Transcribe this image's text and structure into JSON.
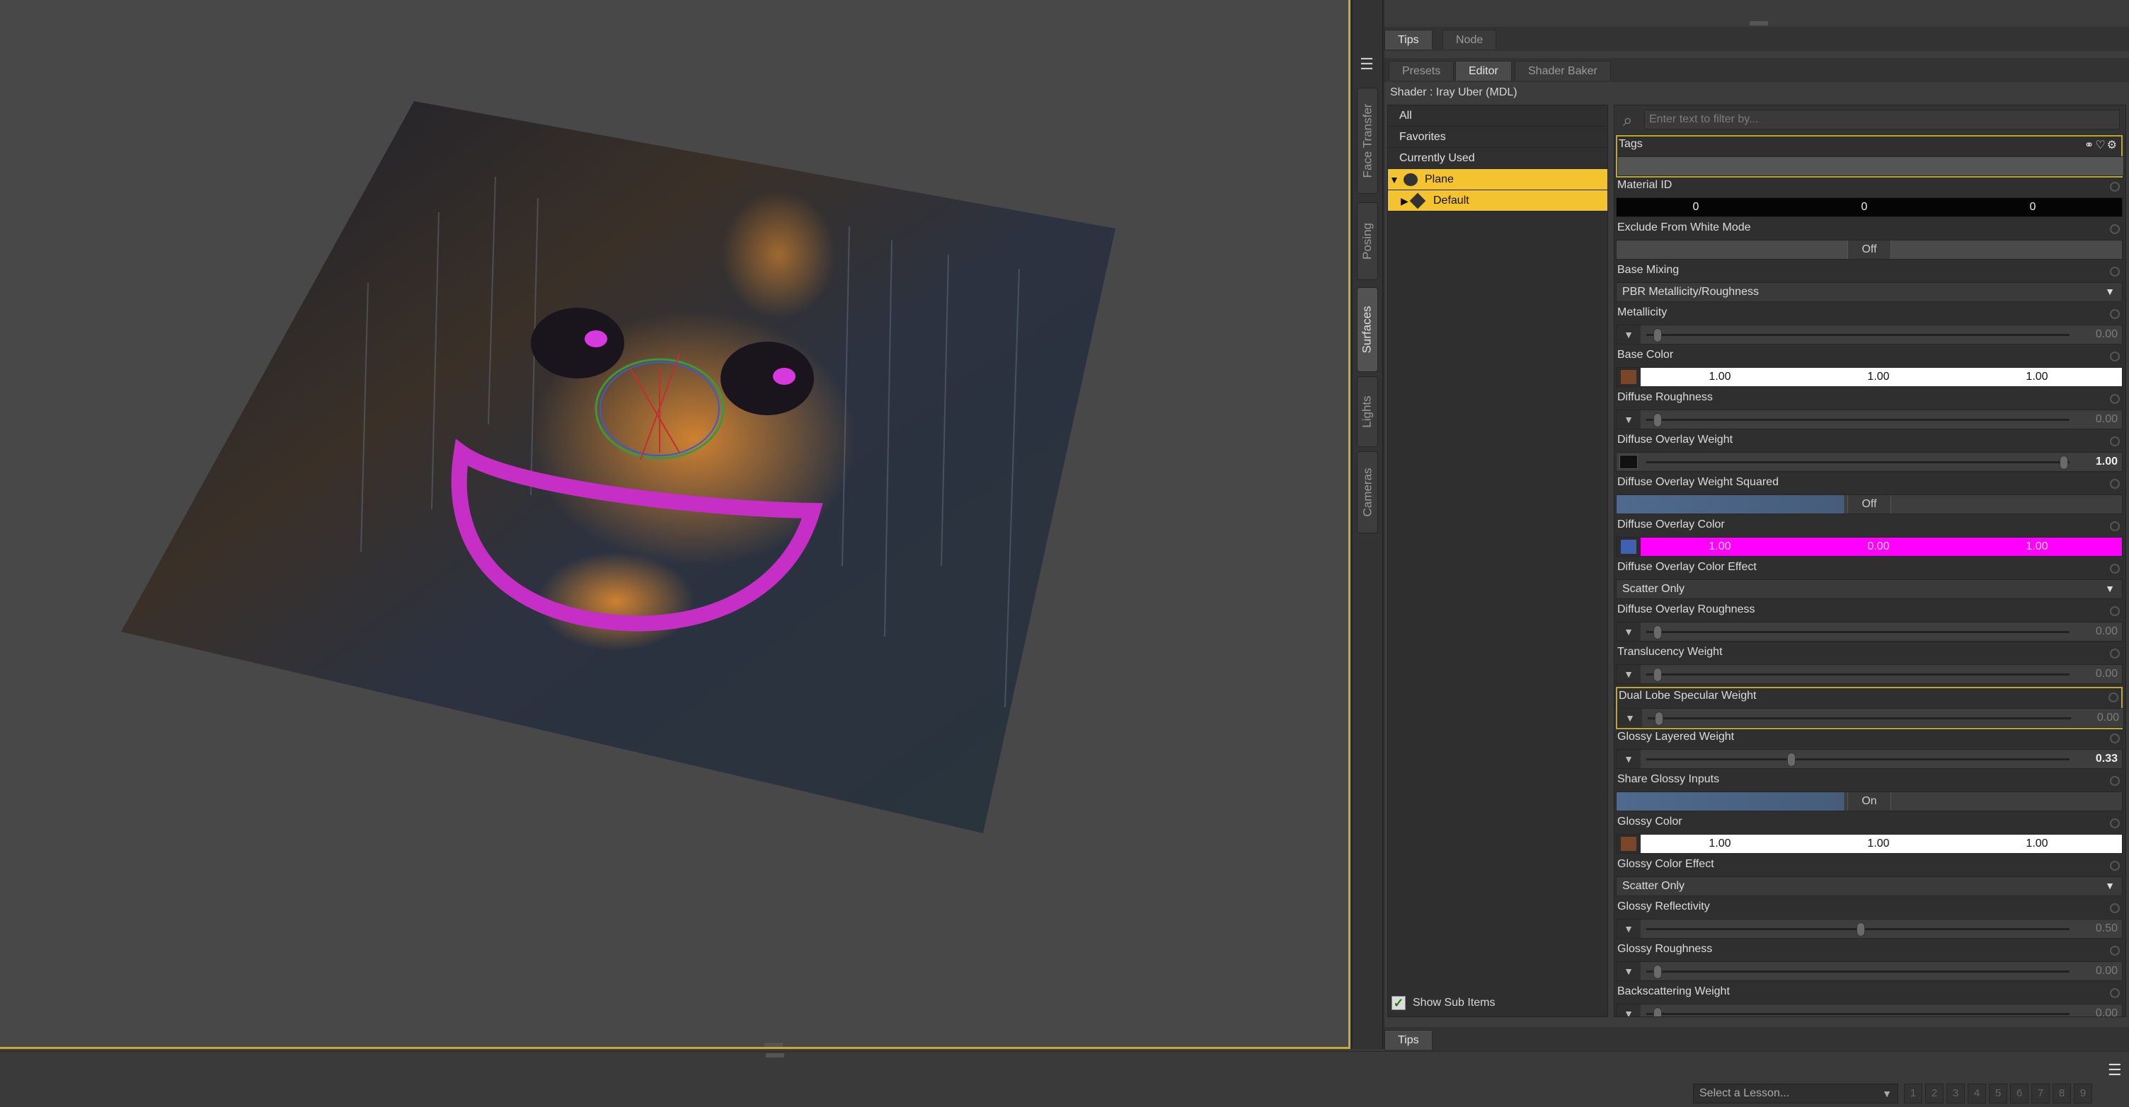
{
  "colors": {
    "accent": "#f4c430",
    "viewport_border": "#c8a838",
    "overlay_magenta": "#ff00ff"
  },
  "side_tabs": [
    "Face Transfer",
    "Posing",
    "Surfaces",
    "Lights",
    "Cameras"
  ],
  "top_tabs": [
    "Tips",
    "Node"
  ],
  "sub_tabs": [
    "Presets",
    "Editor",
    "Shader Baker"
  ],
  "shader_label": "Shader : Iray Uber (MDL)",
  "tree": {
    "items": [
      "All",
      "Favorites",
      "Currently Used",
      "Plane",
      "Default"
    ],
    "show_sub_items": "Show Sub Items"
  },
  "filter": {
    "placeholder": "Enter text to filter by..."
  },
  "properties": [
    {
      "label": "Tags",
      "type": "tags"
    },
    {
      "label": "Material ID",
      "type": "triple_dark",
      "values": [
        "0",
        "0",
        "0"
      ]
    },
    {
      "label": "Exclude From White Mode",
      "type": "toggle_grey",
      "value": "Off"
    },
    {
      "label": "Base Mixing",
      "type": "dropdown",
      "value": "PBR Metallicity/Roughness"
    },
    {
      "label": "Metallicity",
      "type": "slider",
      "value": "0.00",
      "level": 0.0
    },
    {
      "label": "Base Color",
      "type": "color",
      "values": [
        "1.00",
        "1.00",
        "1.00"
      ]
    },
    {
      "label": "Diffuse Roughness",
      "type": "slider",
      "value": "0.00",
      "level": 0.0
    },
    {
      "label": "Diffuse Overlay Weight",
      "type": "slider_map",
      "value": "1.00",
      "level": 1.0
    },
    {
      "label": "Diffuse Overlay Weight Squared",
      "type": "toggle",
      "value": "Off"
    },
    {
      "label": "Diffuse Overlay Color",
      "type": "color_mag",
      "values": [
        "1.00",
        "0.00",
        "1.00"
      ]
    },
    {
      "label": "Diffuse Overlay Color Effect",
      "type": "dropdown",
      "value": "Scatter Only"
    },
    {
      "label": "Diffuse Overlay Roughness",
      "type": "slider",
      "value": "0.00",
      "level": 0.0
    },
    {
      "label": "Translucency Weight",
      "type": "slider",
      "value": "0.00",
      "level": 0.0
    },
    {
      "label": "Dual Lobe Specular Weight",
      "type": "slider",
      "value": "0.00",
      "level": 0.0
    },
    {
      "label": "Glossy Layered Weight",
      "type": "slider",
      "value": "0.33",
      "level": 0.33
    },
    {
      "label": "Share Glossy Inputs",
      "type": "toggle",
      "value": "On"
    },
    {
      "label": "Glossy Color",
      "type": "color",
      "values": [
        "1.00",
        "1.00",
        "1.00"
      ]
    },
    {
      "label": "Glossy Color Effect",
      "type": "dropdown",
      "value": "Scatter Only"
    },
    {
      "label": "Glossy Reflectivity",
      "type": "slider",
      "value": "0.50",
      "level": 0.5
    },
    {
      "label": "Glossy Roughness",
      "type": "slider",
      "value": "0.00",
      "level": 0.0
    },
    {
      "label": "Backscattering Weight",
      "type": "slider",
      "value": "0.00",
      "level": 0.0
    }
  ],
  "bottom_tab": "Tips",
  "status": {
    "lesson": "Select a Lesson...",
    "pages": [
      "1",
      "2",
      "3",
      "4",
      "5",
      "6",
      "7",
      "8",
      "9"
    ]
  }
}
